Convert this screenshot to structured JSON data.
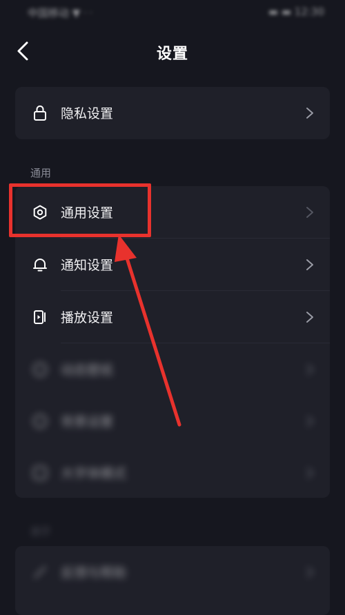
{
  "status_bar": {
    "left": "中国移动 ▼ ᐧ ᐧ",
    "right": "▬ ▬ 12:30"
  },
  "header": {
    "title": "设置"
  },
  "privacy_card": {
    "label": "隐私设置"
  },
  "section_general": {
    "title": "通用"
  },
  "general_items": [
    {
      "label": "通用设置"
    },
    {
      "label": "通知设置"
    },
    {
      "label": "播放设置"
    },
    {
      "label": "动态壁纸"
    },
    {
      "label": "背景设置"
    },
    {
      "label": "大字体模式"
    }
  ],
  "section_about": {
    "title": "关于"
  },
  "about_items": [
    {
      "label": "反馈与帮助"
    }
  ],
  "colors": {
    "background": "#16171f",
    "card": "#1f2029",
    "highlight": "#e8322d",
    "secondary_text": "#8a8c97"
  },
  "icons": [
    "back-icon",
    "lock-icon",
    "gear-icon",
    "bell-icon",
    "play-settings-icon",
    "wallpaper-icon",
    "background-icon",
    "font-icon",
    "feedback-icon",
    "chevron-right-icon"
  ]
}
